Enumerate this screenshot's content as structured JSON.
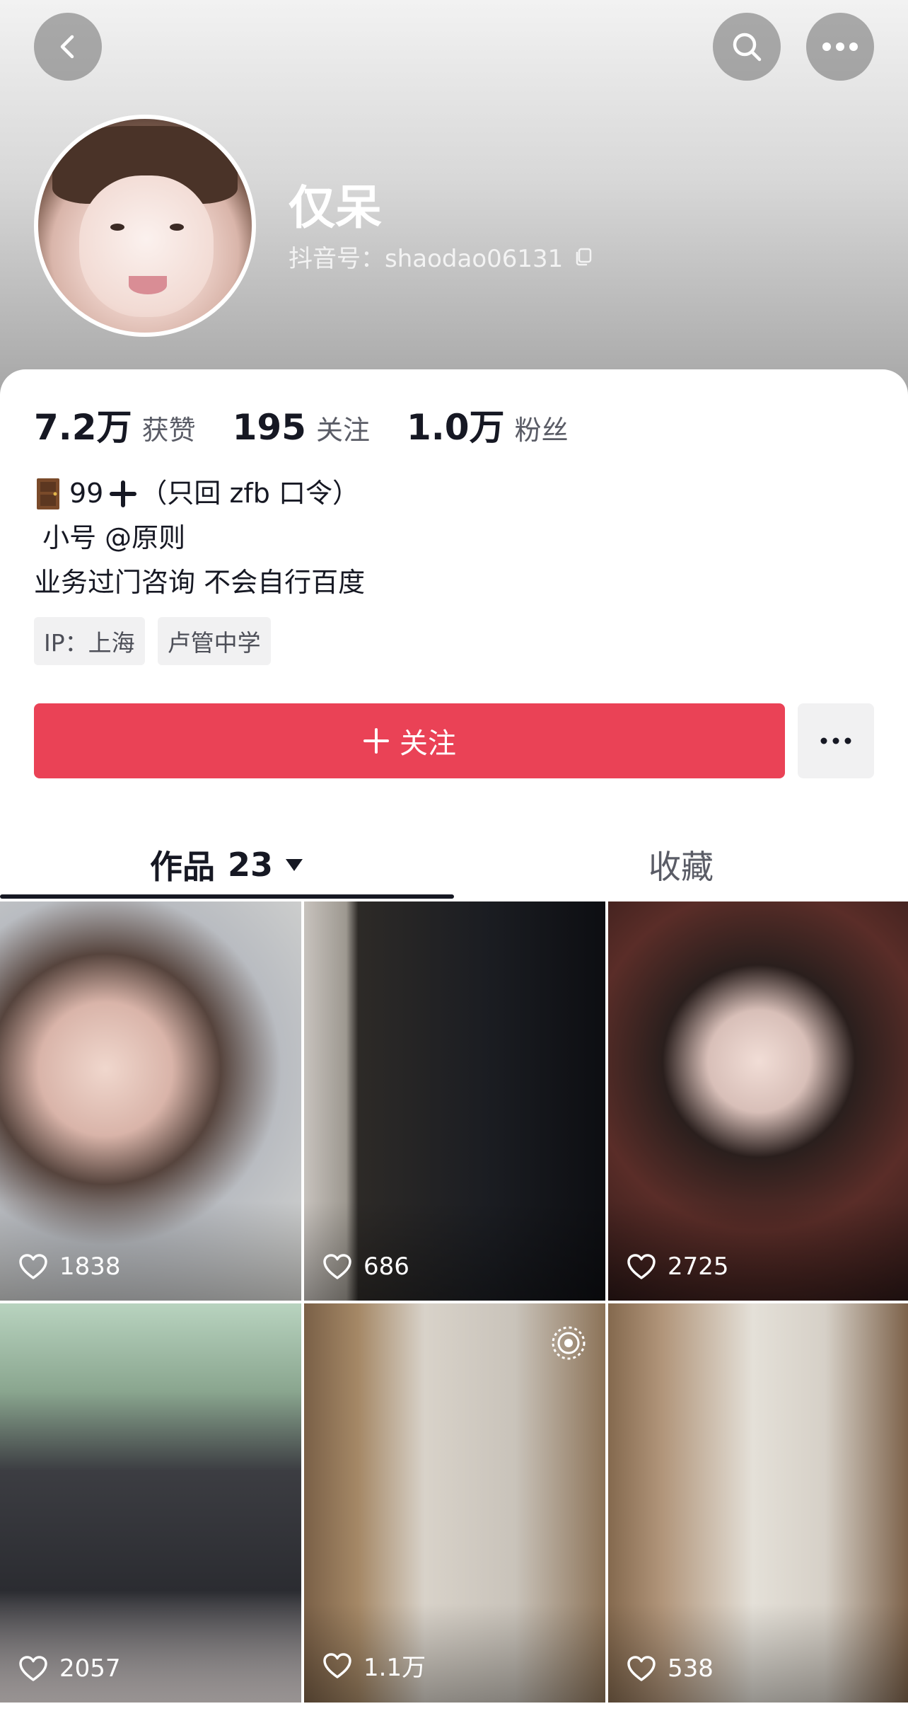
{
  "profile": {
    "nickname": "仅呆",
    "handle": "抖音号：shaodao06131"
  },
  "stats": [
    {
      "value": "7.2万",
      "label": "获赞"
    },
    {
      "value": "195",
      "label": "关注"
    },
    {
      "value": "1.0万",
      "label": "粉丝"
    }
  ],
  "bio": {
    "line1_text": "99",
    "line1_suffix": "（只回 zfb 口令）",
    "line2": " 小号 @原则",
    "line3": "业务过门咨询 不会自行百度"
  },
  "tags": [
    "IP：上海",
    "卢管中学"
  ],
  "actions": {
    "follow_label": "关注"
  },
  "tabs": {
    "works_label": "作品",
    "works_count": "23",
    "favorites_label": "收藏"
  },
  "videos": [
    {
      "likes": "1838"
    },
    {
      "likes": "686"
    },
    {
      "likes": "2725"
    },
    {
      "likes": "2057"
    },
    {
      "likes": "1.1万"
    },
    {
      "likes": "538"
    }
  ],
  "icons": [
    "back-icon",
    "search-icon",
    "more-icon",
    "copy-icon",
    "door-icon",
    "plus-icon",
    "triangle-down-icon",
    "heart-icon",
    "live-icon"
  ],
  "colors": {
    "accent": "#ea4256",
    "text_primary": "#161823",
    "text_secondary": "#5a5c66",
    "tag_bg": "#f1f1f2"
  }
}
